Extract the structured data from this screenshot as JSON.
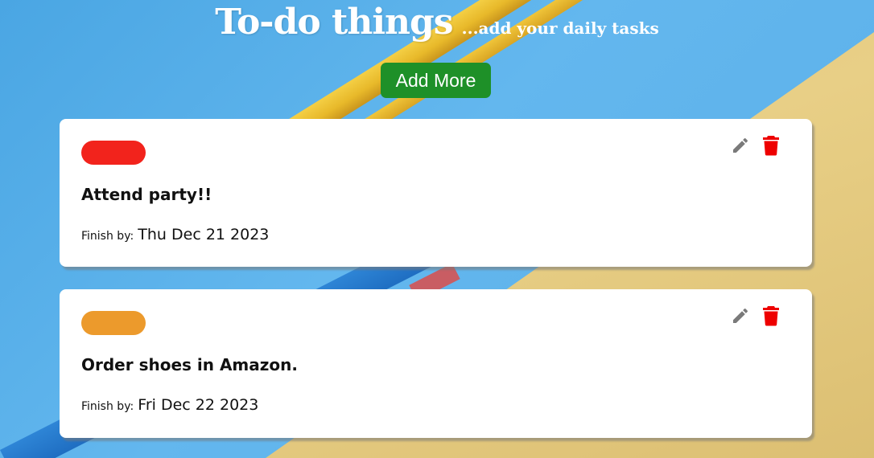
{
  "header": {
    "title": "To-do things",
    "subtitle": "...add your daily tasks"
  },
  "add_button_label": "Add More",
  "finish_label": "Finish by:",
  "tasks": [
    {
      "title": "Attend party!!",
      "date": "Thu Dec 21 2023",
      "tag_color": "#f2231c"
    },
    {
      "title": "Order shoes in Amazon.",
      "date": "Fri Dec 22 2023",
      "tag_color": "#ec9a2c"
    }
  ],
  "icons": {
    "edit": "pencil-icon",
    "delete": "trash-icon"
  },
  "colors": {
    "add_button": "#1e9028",
    "delete_icon": "#ee0000",
    "edit_icon": "#7a7a7a"
  }
}
